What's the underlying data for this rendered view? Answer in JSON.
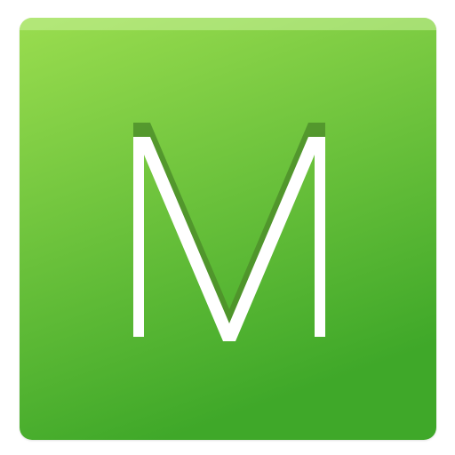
{
  "icon": {
    "name": "m-letter-app-icon",
    "letter": "M",
    "colors": {
      "top": "#9ADD4F",
      "bottom": "#3FA829",
      "highlight": "#C8F19A",
      "letter": "#FFFFFF",
      "letter_shadow": "#4E8F2A"
    }
  }
}
